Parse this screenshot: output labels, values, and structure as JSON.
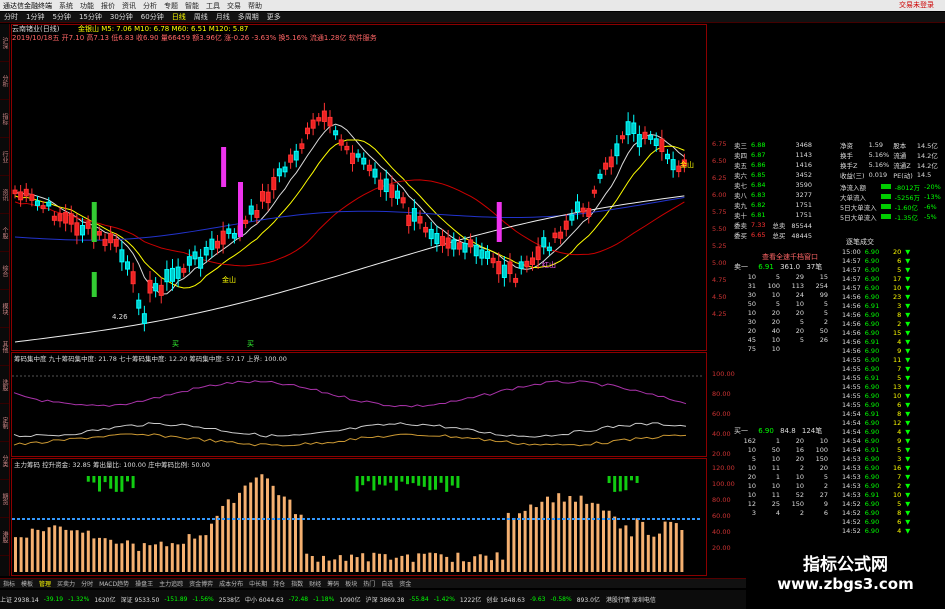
{
  "title_bar": {
    "app": "通达信金融终端",
    "menus": [
      "系统",
      "功能",
      "报价",
      "资讯",
      "分析",
      "专题",
      "智能",
      "工具",
      "交易",
      "帮助"
    ],
    "right_label": "交易未登录"
  },
  "period_tabs": {
    "items": [
      "分时",
      "1分钟",
      "5分钟",
      "15分钟",
      "30分钟",
      "60分钟",
      "日线",
      "周线",
      "月线",
      "多周期",
      "更多"
    ],
    "selected": 6
  },
  "left_strip": [
    "沪深",
    "分析",
    "指标",
    "行业",
    "资讯",
    "个股",
    "综合",
    "模块",
    "其他",
    "选股",
    "定制",
    "分类",
    "期货",
    "港股"
  ],
  "chart_header": {
    "stock": "云南锗业(日线)",
    "ma_line": "金银山  M5: 7.06  M10: 6.78  M60: 6.51  M120: 5.87",
    "quote_line": "2019/10/18五  开7.10  高7.13  低6.83  收6.90  量66459  额3.96亿  涨-0.26  -3.63%  换5.16%  流通1.28亿  软件服务"
  },
  "price_axis": [
    "6.75",
    "6.50",
    "6.25",
    "6.00",
    "5.75",
    "5.50",
    "5.25",
    "5.00",
    "4.75",
    "4.50",
    "4.25"
  ],
  "chart_labels": {
    "low_price": "4.26",
    "gold1": "金山",
    "gold2": "金山",
    "red_mark": "红山",
    "buy1": "买",
    "buy2": "买"
  },
  "indicator1": {
    "header": "筹码集中度  九十筹码集中度: 21.78  七十筹码集中度: 12.20  筹码集中度: 57.17  上界: 100.00",
    "axis": [
      "100.00",
      "80.00",
      "60.00",
      "40.00",
      "20.00"
    ]
  },
  "indicator2": {
    "header": "主力筹码  控升资金: 32.85  筹出量比: 100.00  庄中筹码比例: 50.00",
    "axis": [
      "120.00",
      "100.00",
      "80.00",
      "60.00",
      "40.00",
      "20.00"
    ]
  },
  "order_book": {
    "sells": [
      {
        "label": "卖三",
        "price": "6.88",
        "vol": "3468"
      },
      {
        "label": "卖四",
        "price": "6.87",
        "vol": "1143"
      },
      {
        "label": "卖五",
        "price": "6.86",
        "vol": "1416"
      },
      {
        "label": "卖六",
        "price": "6.85",
        "vol": "3452"
      },
      {
        "label": "卖七",
        "price": "6.84",
        "vol": "3590"
      },
      {
        "label": "卖八",
        "price": "6.83",
        "vol": "3277"
      },
      {
        "label": "卖九",
        "price": "6.82",
        "vol": "1751"
      },
      {
        "label": "卖十",
        "price": "6.81",
        "vol": "1751"
      }
    ],
    "total_sell": {
      "label": "委卖",
      "price": "7.33",
      "tag": "总卖",
      "vol": "85544"
    },
    "total_buy": {
      "label": "委买",
      "price": "6.65",
      "tag": "总买",
      "vol": "48445"
    }
  },
  "stats": [
    {
      "k1": "净资",
      "v1": "1.59",
      "k2": "股本",
      "v2": "14.5亿"
    },
    {
      "k1": "换手",
      "v1": "5.16%",
      "k2": "流通",
      "v2": "14.2亿"
    },
    {
      "k1": "换手Z",
      "v1": "5.16%",
      "k2": "流通Z",
      "v2": "14.2亿"
    },
    {
      "k1": "收益(三)",
      "v1": "0.019",
      "k2": "PE(动)",
      "v2": "14.5"
    }
  ],
  "flows": [
    {
      "label": "净流入额",
      "val": "-8012万",
      "pct": "-20%"
    },
    {
      "label": "大单流入",
      "val": "-5256万",
      "pct": "-13%"
    },
    {
      "label": "5日大单流入",
      "val": "-1.60亿",
      "pct": "-6%"
    },
    {
      "label": "5日大单流入",
      "val": "-1.35亿",
      "pct": "-5%"
    }
  ],
  "ticks_title": "逐笔成交",
  "buy_sell_title": "查看全速千档窗口",
  "sell1": {
    "label": "卖一",
    "price": "6.91",
    "avg": "361.0",
    "count": "37笔"
  },
  "sell_queue": [
    [
      "10",
      "5",
      "29",
      "15"
    ],
    [
      "31",
      "100",
      "113",
      "254"
    ],
    [
      "30",
      "10",
      "24",
      "99"
    ],
    [
      "50",
      "5",
      "10",
      "5"
    ],
    [
      "10",
      "20",
      "20",
      "5"
    ],
    [
      "30",
      "20",
      "5",
      "2"
    ],
    [
      "20",
      "40",
      "20",
      "50"
    ],
    [
      "45",
      "10",
      "5",
      "26"
    ],
    [
      "75",
      "10",
      "",
      ""
    ]
  ],
  "buy1": {
    "label": "买一",
    "price": "6.90",
    "avg": "84.8",
    "count": "124笔"
  },
  "buy_queue": [
    [
      "162",
      "1",
      "20",
      "10"
    ],
    [
      "10",
      "50",
      "16",
      "100"
    ],
    [
      "5",
      "10",
      "20",
      "150"
    ],
    [
      "10",
      "11",
      "2",
      "20"
    ],
    [
      "20",
      "1",
      "10",
      "5"
    ],
    [
      "10",
      "10",
      "10",
      "2"
    ],
    [
      "10",
      "11",
      "52",
      "27"
    ],
    [
      "12",
      "25",
      "150",
      "9"
    ],
    [
      "3",
      "4",
      "2",
      "6"
    ]
  ],
  "tick_rows": [
    [
      "15:00",
      "6.90",
      "20"
    ],
    [
      "14:57",
      "6.90",
      "6"
    ],
    [
      "14:57",
      "6.90",
      "5"
    ],
    [
      "14:57",
      "6.90",
      "17"
    ],
    [
      "14:57",
      "6.90",
      "10"
    ],
    [
      "14:56",
      "6.90",
      "23"
    ],
    [
      "14:56",
      "6.91",
      "3"
    ],
    [
      "14:56",
      "6.90",
      "8"
    ],
    [
      "14:56",
      "6.90",
      "2"
    ],
    [
      "14:56",
      "6.90",
      "15"
    ],
    [
      "14:56",
      "6.91",
      "4"
    ],
    [
      "14:56",
      "6.90",
      "9"
    ],
    [
      "14:55",
      "6.90",
      "11"
    ],
    [
      "14:55",
      "6.90",
      "7"
    ],
    [
      "14:55",
      "6.91",
      "5"
    ],
    [
      "14:55",
      "6.90",
      "13"
    ],
    [
      "14:55",
      "6.90",
      "10"
    ],
    [
      "14:55",
      "6.90",
      "6"
    ],
    [
      "14:54",
      "6.91",
      "8"
    ],
    [
      "14:54",
      "6.90",
      "12"
    ],
    [
      "14:54",
      "6.90",
      "4"
    ],
    [
      "14:54",
      "6.90",
      "9"
    ],
    [
      "14:54",
      "6.91",
      "5"
    ],
    [
      "14:53",
      "6.90",
      "3"
    ],
    [
      "14:53",
      "6.90",
      "16"
    ],
    [
      "14:53",
      "6.90",
      "7"
    ],
    [
      "14:53",
      "6.90",
      "2"
    ],
    [
      "14:53",
      "6.91",
      "10"
    ],
    [
      "14:52",
      "6.90",
      "5"
    ],
    [
      "14:52",
      "6.90",
      "8"
    ],
    [
      "14:52",
      "6.90",
      "6"
    ],
    [
      "14:52",
      "6.90",
      "4"
    ]
  ],
  "bottom_tabs": [
    "指标",
    "模板",
    "管理",
    "买卖力",
    "分时",
    "MACD趋势",
    "操盘王",
    "主力追踪",
    "资金博弈",
    "成本分布",
    "中长期",
    "持仓",
    "指数",
    "财经",
    "筹码",
    "板块",
    "热门",
    "自选",
    "资金"
  ],
  "status_bar": [
    {
      "t": "上证 2938.14",
      "c": "w"
    },
    {
      "t": "-39.19",
      "c": "g"
    },
    {
      "t": "-1.32%",
      "c": "g"
    },
    {
      "t": "1620亿",
      "c": "w"
    },
    {
      "t": "深证 9533.50",
      "c": "w"
    },
    {
      "t": "-151.89",
      "c": "g"
    },
    {
      "t": "-1.56%",
      "c": "g"
    },
    {
      "t": "2538亿",
      "c": "w"
    },
    {
      "t": "中小 6044.63",
      "c": "w"
    },
    {
      "t": "-72.48",
      "c": "g"
    },
    {
      "t": "-1.18%",
      "c": "g"
    },
    {
      "t": "1090亿",
      "c": "w"
    },
    {
      "t": "沪深 3869.38",
      "c": "w"
    },
    {
      "t": "-55.84",
      "c": "g"
    },
    {
      "t": "-1.42%",
      "c": "g"
    },
    {
      "t": "1222亿",
      "c": "w"
    },
    {
      "t": "创业 1648.63",
      "c": "w"
    },
    {
      "t": "-9.63",
      "c": "g"
    },
    {
      "t": "-0.58%",
      "c": "g"
    },
    {
      "t": "893.0亿",
      "c": "w"
    }
  ],
  "status_right": "港股行情 深圳电信",
  "watermark": {
    "line1": "指标公式网",
    "line2": "www.zbgs3.com"
  }
}
